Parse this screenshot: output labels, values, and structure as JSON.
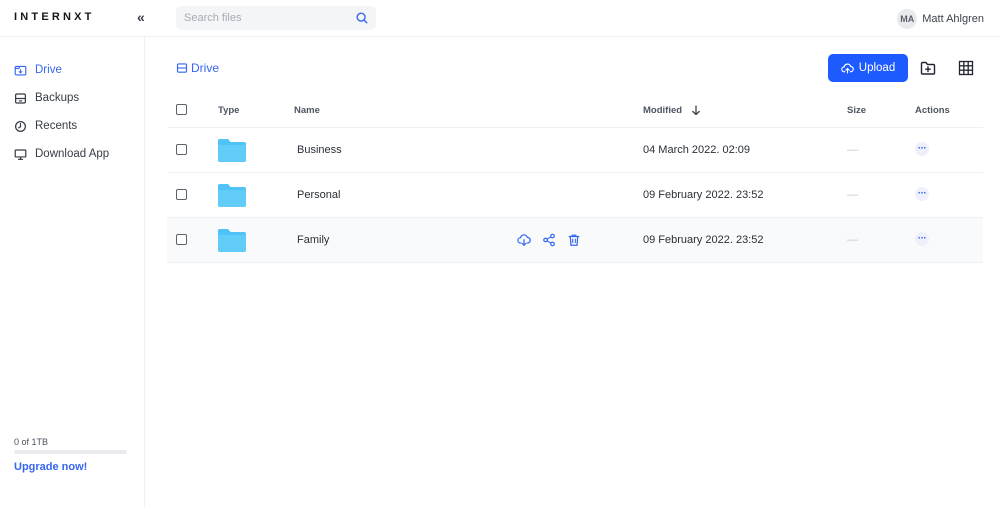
{
  "app": {
    "logo": "INTERNXT",
    "collapse_label": "«"
  },
  "search": {
    "placeholder": "Search files"
  },
  "user": {
    "initials": "MA",
    "name": "Matt Ahlgren"
  },
  "sidebar": {
    "items": [
      {
        "label": "Drive",
        "icon": "drive-icon",
        "active": true
      },
      {
        "label": "Backups",
        "icon": "backups-icon",
        "active": false
      },
      {
        "label": "Recents",
        "icon": "clock-icon",
        "active": false
      },
      {
        "label": "Download App",
        "icon": "desktop-icon",
        "active": false
      }
    ],
    "usage_text": "0 of 1TB",
    "usage_fraction": 0,
    "upgrade_label": "Upgrade now!"
  },
  "breadcrumb": {
    "label": "Drive"
  },
  "toolbar": {
    "upload_label": "Upload"
  },
  "table": {
    "headers": {
      "type": "Type",
      "name": "Name",
      "modified": "Modified",
      "size": "Size",
      "actions": "Actions"
    },
    "rows": [
      {
        "name": "Business",
        "modified": "04 March 2022. 02:09",
        "size": "—"
      },
      {
        "name": "Personal",
        "modified": "09 February 2022. 23:52",
        "size": "—"
      },
      {
        "name": "Family",
        "modified": "09 February 2022. 23:52",
        "size": "—"
      }
    ]
  },
  "colors": {
    "accent": "#1d5bff",
    "link": "#3566f1",
    "folder": "#4fc3f7"
  }
}
